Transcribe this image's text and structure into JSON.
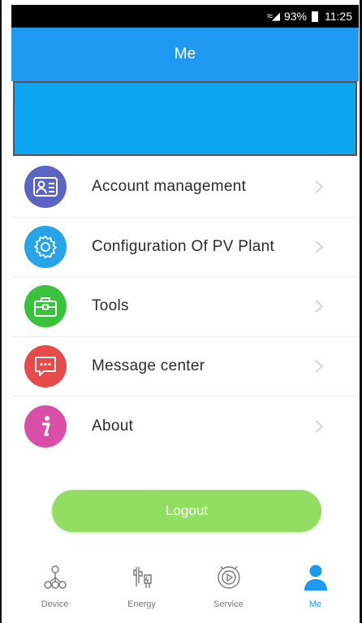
{
  "status_bar": {
    "battery": "93%",
    "time": "11:25"
  },
  "header": {
    "title": "Me"
  },
  "menu": {
    "items": [
      {
        "label": "Account management",
        "icon": "account-card-icon",
        "color": "#5b65c4"
      },
      {
        "label": "Configuration Of PV Plant",
        "icon": "gear-icon",
        "color": "#27a3e8"
      },
      {
        "label": "Tools",
        "icon": "toolbox-icon",
        "color": "#39c23b"
      },
      {
        "label": "Message center",
        "icon": "chat-bubble-icon",
        "color": "#e64a4a"
      },
      {
        "label": "About",
        "icon": "info-icon",
        "color": "#d94fa8"
      }
    ]
  },
  "logout": {
    "label": "Logout"
  },
  "bottom_nav": {
    "items": [
      {
        "label": "Device",
        "icon": "device-network-icon"
      },
      {
        "label": "Energy",
        "icon": "energy-icon"
      },
      {
        "label": "Service",
        "icon": "service-icon"
      },
      {
        "label": "Me",
        "icon": "person-icon"
      }
    ],
    "active": "Me",
    "active_color": "#1e98f0"
  }
}
